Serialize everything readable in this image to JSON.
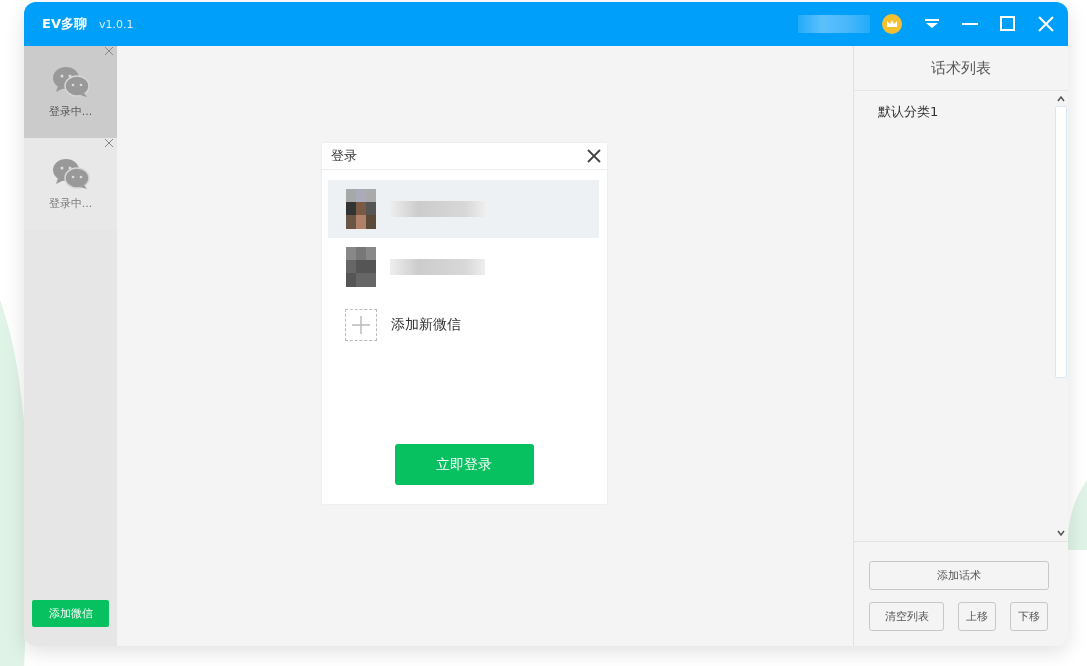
{
  "window": {
    "title": "EV多聊",
    "version": "v1.0.1"
  },
  "sessions": [
    {
      "label": "登录中...",
      "selected": true
    },
    {
      "label": "登录中...",
      "selected": false
    }
  ],
  "add_wechat_button": "添加微信",
  "login_dialog": {
    "title": "登录",
    "accounts": [
      {
        "selected": true
      },
      {
        "selected": false
      }
    ],
    "add_new": "添加新微信",
    "login_button": "立即登录"
  },
  "script_panel": {
    "title": "话术列表",
    "categories": [
      "默认分类1"
    ],
    "add_button": "添加话术",
    "clear_button": "清空列表",
    "up_button": "上移",
    "down_button": "下移"
  }
}
